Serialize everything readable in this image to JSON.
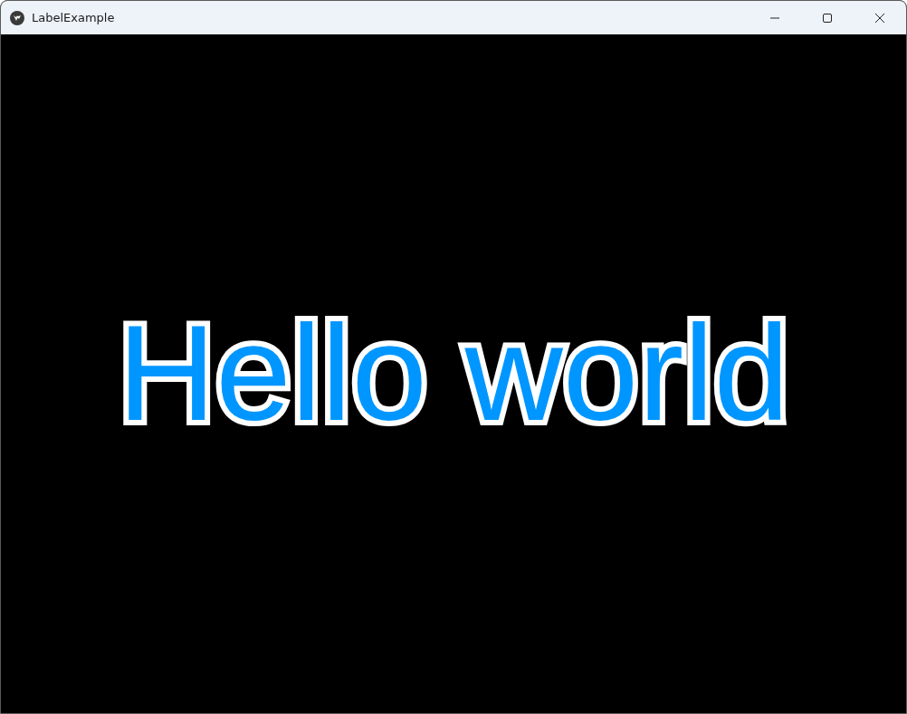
{
  "window": {
    "title": "LabelExample"
  },
  "label": {
    "text": "Hello world"
  }
}
